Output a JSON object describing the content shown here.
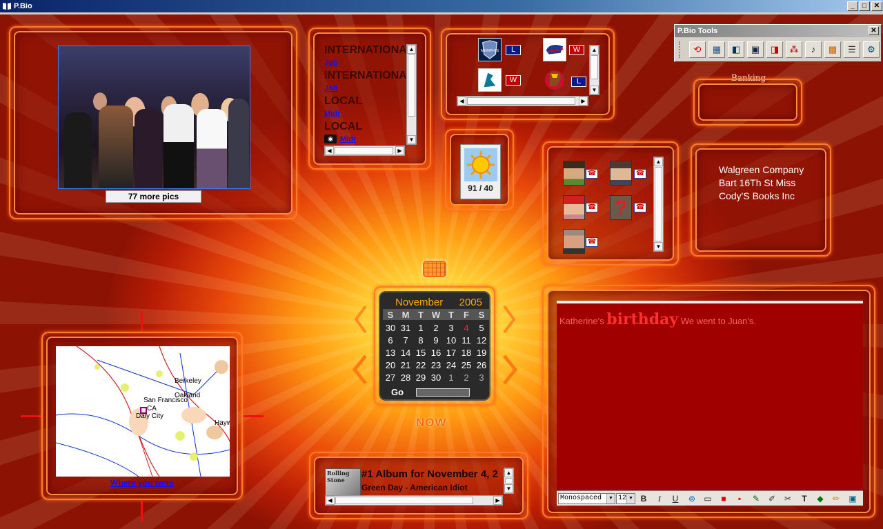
{
  "window": {
    "title": "P.Bio",
    "controls": {
      "minimize": "_",
      "maximize": "□",
      "close": "✕"
    }
  },
  "photos": {
    "more_label": "77 more pics"
  },
  "news": {
    "items": [
      {
        "headline": "INTERNATIONAL",
        "link": "Job"
      },
      {
        "headline": "INTERNATIONAL",
        "link": "Job"
      },
      {
        "headline": "LOCAL",
        "link": "Midr"
      },
      {
        "headline": "LOCAL",
        "link": "Midr"
      }
    ],
    "camera_icon": "camera-icon"
  },
  "sports": {
    "games": [
      {
        "team": "Memphis Grizzlies",
        "result": "L"
      },
      {
        "team": "Buffalo Bills",
        "result": "W"
      },
      {
        "team": "Florida Marlins",
        "result": "W"
      },
      {
        "team": "Chicago Blackhawks",
        "result": "L"
      }
    ]
  },
  "weather": {
    "temps": "91 / 40",
    "icon": "sun-icon"
  },
  "tools": {
    "title": "P.Bio Tools",
    "close": "✕",
    "buttons": [
      "refresh",
      "map",
      "contacts",
      "save",
      "alert",
      "network",
      "music",
      "gallery",
      "news",
      "settings"
    ]
  },
  "banking": {
    "label": "Banking"
  },
  "contacts": {
    "phone_icon": "☎"
  },
  "addresses": {
    "lines": [
      "Walgreen Company",
      "Bart 16Th St Miss",
      "Cody'S Books Inc"
    ]
  },
  "calendar": {
    "month": "November",
    "year": "2005",
    "dow": [
      "S",
      "M",
      "T",
      "W",
      "T",
      "F",
      "S"
    ],
    "weeks": [
      [
        "30",
        "31",
        "1",
        "2",
        "3",
        "4",
        "5"
      ],
      [
        "6",
        "7",
        "8",
        "9",
        "10",
        "11",
        "12"
      ],
      [
        "13",
        "14",
        "15",
        "16",
        "17",
        "18",
        "19"
      ],
      [
        "20",
        "21",
        "22",
        "23",
        "24",
        "25",
        "26"
      ],
      [
        "27",
        "28",
        "29",
        "30",
        "1",
        "2",
        "3"
      ]
    ],
    "today": "4",
    "go_label": "Go",
    "now_label": "NOW"
  },
  "map": {
    "link": "Where you were",
    "labels": [
      "Berkeley",
      "Oakland",
      "San Francisco",
      "CA",
      "Daly City",
      "Hayw"
    ]
  },
  "album": {
    "title": "#1 Album for November 4, 2",
    "artist": "Green Day - American Idiot",
    "magazine": "Rolling Stone"
  },
  "journal": {
    "prefix": "Katherine's",
    "emphasis": "birthday",
    "suffix": "We went to Juan's.",
    "font": "Monospaced",
    "font_size": "12",
    "format_buttons": [
      "B",
      "I",
      "U"
    ]
  },
  "colors": {
    "accent": "#ff7a2a",
    "journal_bg": "#a00000",
    "calendar_today": "#ff2020"
  }
}
